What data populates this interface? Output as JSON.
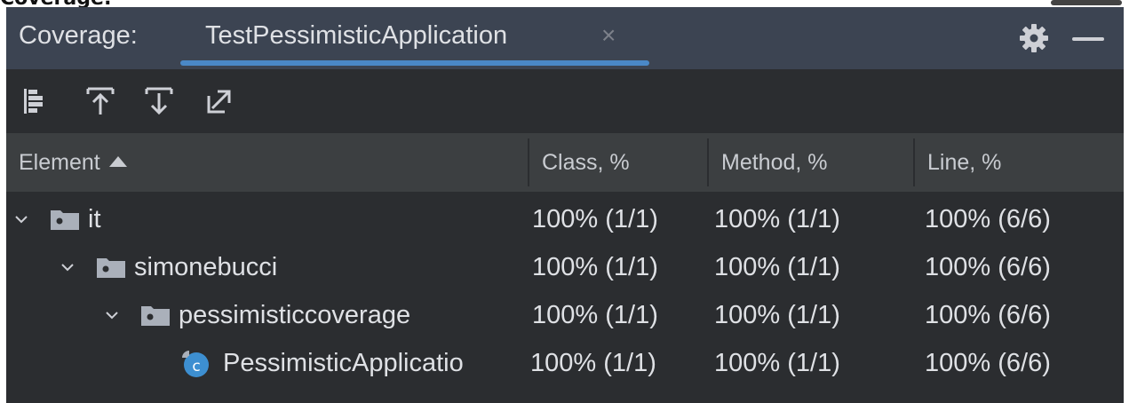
{
  "caption": "Coverage:",
  "panel": {
    "title": "Coverage:",
    "tab": {
      "label": "TestPessimisticApplication",
      "close_glyph": "×"
    },
    "icons": {
      "settings": "gear-icon",
      "minimize": "minimize-icon"
    }
  },
  "toolbar": {
    "items": [
      {
        "icon": "flatten-packages-icon"
      },
      {
        "icon": "import-icon"
      },
      {
        "icon": "export-icon"
      },
      {
        "icon": "navigate-to-source-icon"
      }
    ]
  },
  "table": {
    "columns": [
      {
        "label": "Element",
        "sorted": "ascending"
      },
      {
        "label": "Class, %"
      },
      {
        "label": "Method, %"
      },
      {
        "label": "Line, %"
      }
    ],
    "rows": [
      {
        "name": "it",
        "type": "package",
        "expanded": true,
        "class": "100% (1/1)",
        "method": "100% (1/1)",
        "line": "100% (6/6)"
      },
      {
        "name": "simonebucci",
        "type": "package",
        "expanded": true,
        "class": "100% (1/1)",
        "method": "100% (1/1)",
        "line": "100% (6/6)"
      },
      {
        "name": "pessimisticcoverage",
        "type": "package",
        "expanded": true,
        "class": "100% (1/1)",
        "method": "100% (1/1)",
        "line": "100% (6/6)"
      },
      {
        "name": "PessimisticApplicatio",
        "type": "class",
        "expanded": false,
        "class": "100% (1/1)",
        "method": "100% (1/1)",
        "line": "100% (6/6)"
      }
    ]
  },
  "colors": {
    "panel_bg": "#2b2d30",
    "header_bg": "#3c4452",
    "accent": "#4a88c7",
    "class_icon": "#3d8fd1"
  }
}
